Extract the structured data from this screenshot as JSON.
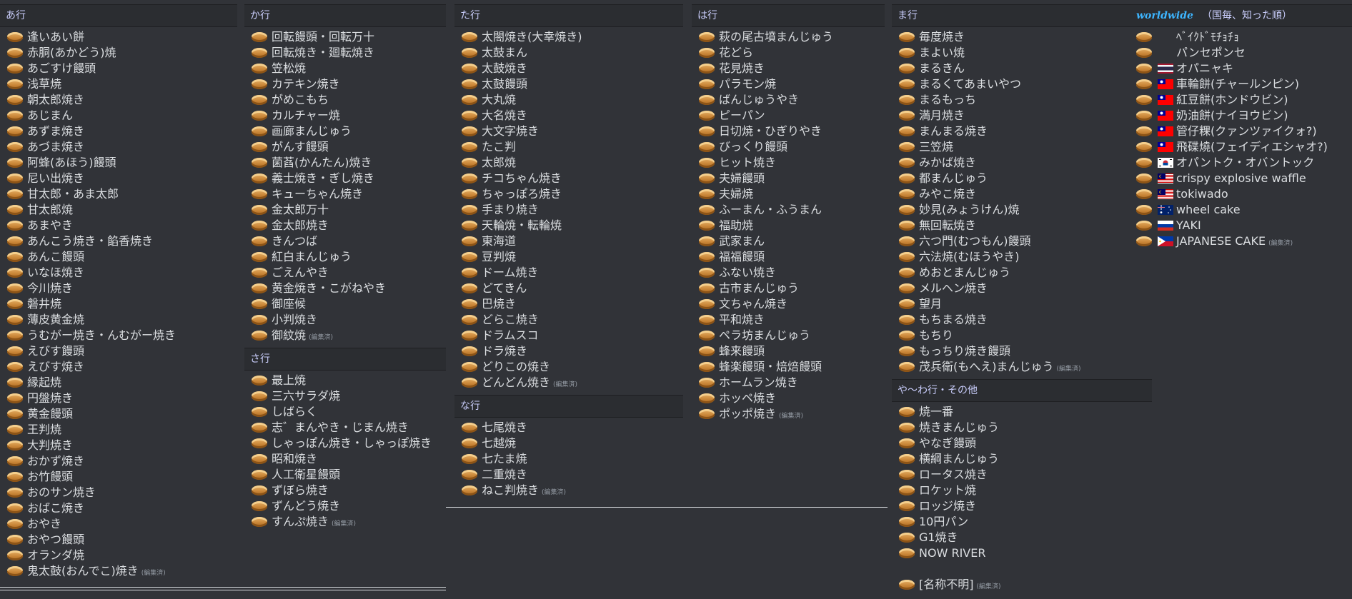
{
  "edited_label": "(編集済)",
  "columns": [
    {
      "sections": [
        {
          "title": "あ行",
          "items": [
            {
              "t": "逢いあい餅"
            },
            {
              "t": "赤胴(あかどう)焼"
            },
            {
              "t": "あごすけ饅頭"
            },
            {
              "t": "浅草焼"
            },
            {
              "t": "朝太郎焼き"
            },
            {
              "t": "あじまん"
            },
            {
              "t": "あずま焼き"
            },
            {
              "t": "あづま焼き"
            },
            {
              "t": "阿蜂(あほう)饅頭"
            },
            {
              "t": "尼い出焼き"
            },
            {
              "t": "甘太郎・あま太郎"
            },
            {
              "t": "甘太郎焼"
            },
            {
              "t": "あまやき"
            },
            {
              "t": "あんこう焼き・餡香焼き"
            },
            {
              "t": "あんこ饅頭"
            },
            {
              "t": "いなほ焼き"
            },
            {
              "t": "今川焼き"
            },
            {
              "t": "磐井焼"
            },
            {
              "t": "薄皮黄金焼"
            },
            {
              "t": "うむがー焼き・んむがー焼き"
            },
            {
              "t": "えびす饅頭"
            },
            {
              "t": "えびす焼き"
            },
            {
              "t": "縁起焼"
            },
            {
              "t": "円盤焼き"
            },
            {
              "t": "黄金饅頭"
            },
            {
              "t": "王判焼"
            },
            {
              "t": "大判焼き"
            },
            {
              "t": "おかず焼き"
            },
            {
              "t": "お竹饅頭"
            },
            {
              "t": "おのサン焼き"
            },
            {
              "t": "おばこ焼き"
            },
            {
              "t": "おやき"
            },
            {
              "t": "おやつ饅頭"
            },
            {
              "t": "オランダ焼"
            },
            {
              "t": "鬼太鼓(おんでこ)焼き",
              "ed": true
            }
          ]
        }
      ]
    },
    {
      "sections": [
        {
          "title": "か行",
          "items": [
            {
              "t": "回転饅頭・回転万十"
            },
            {
              "t": "回転焼き・廻転焼き"
            },
            {
              "t": "笠松焼"
            },
            {
              "t": "カテキン焼き"
            },
            {
              "t": "がめこもち"
            },
            {
              "t": "カルチャー焼"
            },
            {
              "t": "画廊まんじゅう"
            },
            {
              "t": "がんす饅頭"
            },
            {
              "t": "菌萏(かんたん)焼き"
            },
            {
              "t": "義士焼き・ぎし焼き"
            },
            {
              "t": "キューちゃん焼き"
            },
            {
              "t": "金太郎万十"
            },
            {
              "t": "金太郎焼き"
            },
            {
              "t": "きんつば"
            },
            {
              "t": "紅白まんじゅう"
            },
            {
              "t": "ごえんやき"
            },
            {
              "t": "黄金焼き・こがねやき"
            },
            {
              "t": "御座候"
            },
            {
              "t": "小判焼き"
            },
            {
              "t": "御紋焼",
              "ed": true
            }
          ]
        },
        {
          "title": "さ行",
          "items": [
            {
              "t": "最上焼"
            },
            {
              "t": "三六サラダ焼"
            },
            {
              "t": "しばらく"
            },
            {
              "t": "志゛まんやき・じまん焼き"
            },
            {
              "t": "しゃっぽん焼き・しゃっぽ焼き"
            },
            {
              "t": "昭和焼き"
            },
            {
              "t": "人工衛星饅頭"
            },
            {
              "t": "ずぼら焼き"
            },
            {
              "t": "ずんどう焼き"
            },
            {
              "t": "すんぷ焼き",
              "ed": true
            }
          ]
        }
      ]
    },
    {
      "sections": [
        {
          "title": "た行",
          "items": [
            {
              "t": "太閤焼き(大幸焼き)"
            },
            {
              "t": "太鼓まん"
            },
            {
              "t": "太鼓焼き"
            },
            {
              "t": "太鼓饅頭"
            },
            {
              "t": "大丸焼"
            },
            {
              "t": "大名焼き"
            },
            {
              "t": "大文字焼き"
            },
            {
              "t": "たこ判"
            },
            {
              "t": "太郎焼"
            },
            {
              "t": "チコちゃん焼き"
            },
            {
              "t": "ちゃっぽろ焼き"
            },
            {
              "t": "手まり焼き"
            },
            {
              "t": "天輪焼・転輪焼"
            },
            {
              "t": "東海道"
            },
            {
              "t": "豆判焼"
            },
            {
              "t": "ドーム焼き"
            },
            {
              "t": "どてきん"
            },
            {
              "t": "巴焼き"
            },
            {
              "t": "どらこ焼き"
            },
            {
              "t": "ドラムスコ"
            },
            {
              "t": "ドラ焼き"
            },
            {
              "t": "どりこの焼き"
            },
            {
              "t": "どんどん焼き",
              "ed": true
            }
          ]
        },
        {
          "title": "な行",
          "items": [
            {
              "t": "七尾焼き"
            },
            {
              "t": "七越焼"
            },
            {
              "t": "七たま焼"
            },
            {
              "t": "二重焼き"
            },
            {
              "t": "ねこ判焼き",
              "ed": true
            }
          ]
        }
      ]
    },
    {
      "sections": [
        {
          "title": "は行",
          "items": [
            {
              "t": "萩の尾古墳まんじゅう"
            },
            {
              "t": "花どら"
            },
            {
              "t": "花見焼き"
            },
            {
              "t": "パラモン焼"
            },
            {
              "t": "ばんじゅうやき"
            },
            {
              "t": "ピーパン"
            },
            {
              "t": "日切焼・ひぎりやき"
            },
            {
              "t": "びっくり饅頭"
            },
            {
              "t": "ヒット焼き"
            },
            {
              "t": "夫婦饅頭"
            },
            {
              "t": "夫婦焼"
            },
            {
              "t": "ふーまん・ふうまん"
            },
            {
              "t": "福助焼"
            },
            {
              "t": "武家まん"
            },
            {
              "t": "福福饅頭"
            },
            {
              "t": "ふない焼き"
            },
            {
              "t": "古市まんじゅう"
            },
            {
              "t": "文ちゃん焼き"
            },
            {
              "t": "平和焼き"
            },
            {
              "t": "ペラ坊まんじゅう"
            },
            {
              "t": "蜂来饅頭"
            },
            {
              "t": "蜂楽饅頭・焙焙饅頭"
            },
            {
              "t": "ホームラン焼き"
            },
            {
              "t": "ホッペ焼き"
            },
            {
              "t": "ポッポ焼き",
              "ed": true
            }
          ]
        }
      ]
    },
    {
      "sections": [
        {
          "title": "ま行",
          "items": [
            {
              "t": "毎度焼き"
            },
            {
              "t": "まよい焼"
            },
            {
              "t": "まるきん"
            },
            {
              "t": "まるくてあまいやつ"
            },
            {
              "t": "まるもっち"
            },
            {
              "t": "満月焼き"
            },
            {
              "t": "まんまる焼き"
            },
            {
              "t": "三笠焼"
            },
            {
              "t": "みかば焼き"
            },
            {
              "t": "都まんじゅう"
            },
            {
              "t": "みやこ焼き"
            },
            {
              "t": "妙見(みょうけん)焼"
            },
            {
              "t": "無回転焼き"
            },
            {
              "t": "六つ門(むつもん)饅頭"
            },
            {
              "t": "六法焼(むほうやき)"
            },
            {
              "t": "めおとまんじゅう"
            },
            {
              "t": "メルヘン焼き"
            },
            {
              "t": "望月"
            },
            {
              "t": "もちまる焼き"
            },
            {
              "t": "もちり"
            },
            {
              "t": "もっちり焼き饅頭"
            },
            {
              "t": "茂兵衛(もへえ)まんじゅう",
              "ed": true
            }
          ]
        },
        {
          "title": "や〜わ行・その他",
          "items": [
            {
              "t": "焼一番"
            },
            {
              "t": "焼きまんじゅう"
            },
            {
              "t": "やなぎ饅頭"
            },
            {
              "t": "横綱まんじゅう"
            },
            {
              "t": "ロータス焼き"
            },
            {
              "t": "ロケット焼"
            },
            {
              "t": "ロッジ焼き"
            },
            {
              "t": "10円パン"
            },
            {
              "t": "G1焼き"
            },
            {
              "t": "NOW RIVER"
            },
            {
              "t": "",
              "blank": true
            },
            {
              "t": "[名称不明]",
              "ed": true
            }
          ]
        }
      ]
    },
    {
      "worldwide": true,
      "sections": [
        {
          "title": "worldwide",
          "note": "（国毎、知った順）",
          "items": [
            {
              "t": "ﾍﾞｲｸﾄﾞﾓﾁｮﾁｮ",
              "flag": "none"
            },
            {
              "t": "パンセポンセ",
              "flag": "none"
            },
            {
              "t": "オパニャキ",
              "flag": "th"
            },
            {
              "t": "車輪餅(チャールンピン)",
              "flag": "tw"
            },
            {
              "t": "紅豆餅(ホンドウビン)",
              "flag": "tw"
            },
            {
              "t": "奶油餅(ナイヨウビン)",
              "flag": "tw"
            },
            {
              "t": "管仔粿(クァンツァイクォ?)",
              "flag": "tw"
            },
            {
              "t": "飛碟燒(フェイディエシャオ?)",
              "flag": "tw"
            },
            {
              "t": "オパントク・オバントック",
              "flag": "kr"
            },
            {
              "t": "crispy explosive waffle",
              "flag": "my"
            },
            {
              "t": "tokiwado",
              "flag": "my"
            },
            {
              "t": "wheel cake",
              "flag": "au"
            },
            {
              "t": "YAKI",
              "flag": "ru"
            },
            {
              "t": "JAPANESE CAKE",
              "flag": "ph",
              "ed": true
            }
          ]
        }
      ]
    }
  ]
}
